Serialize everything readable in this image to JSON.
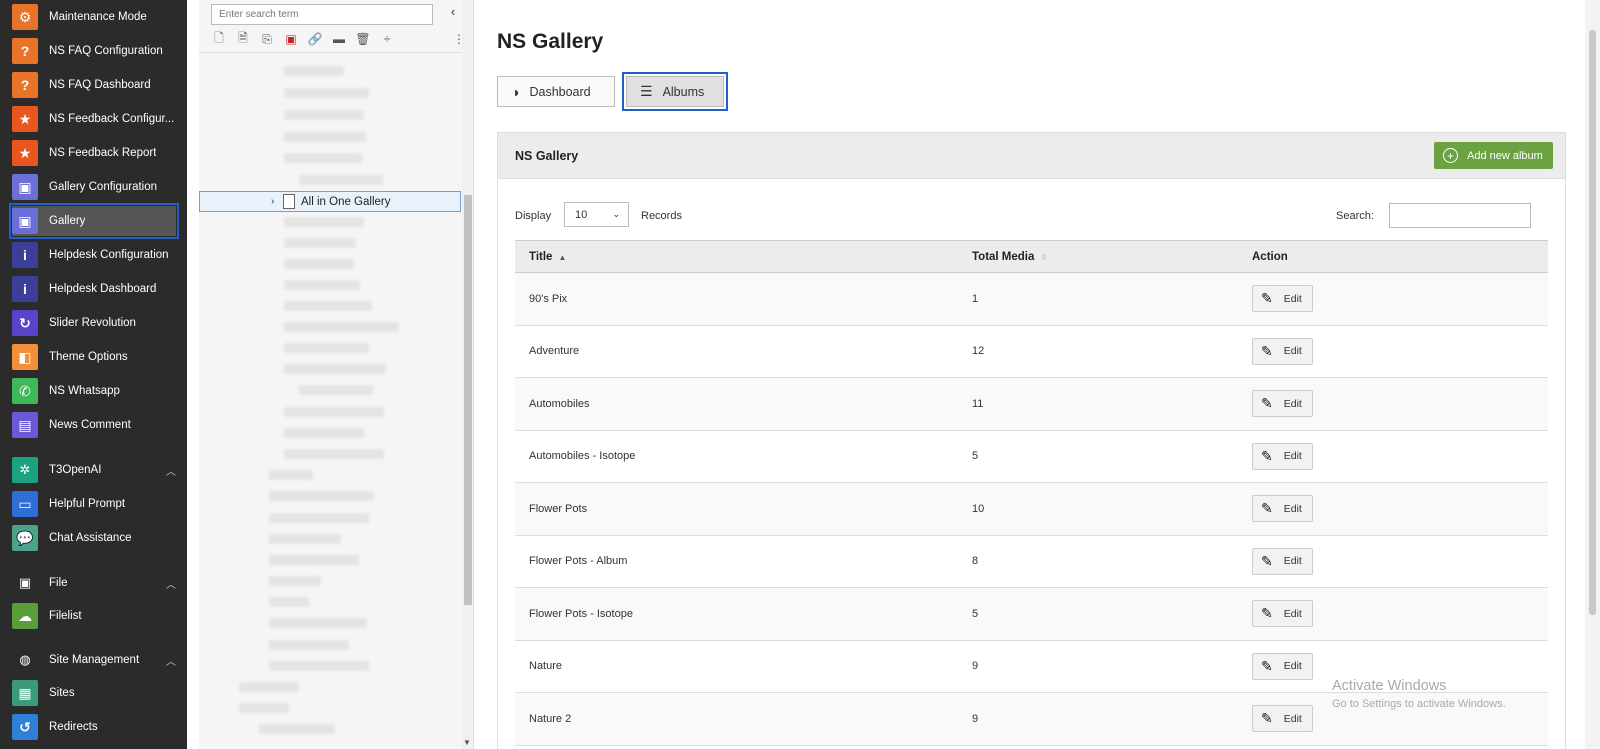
{
  "module_menu": {
    "items": [
      {
        "label": "Maintenance Mode",
        "icon": "gear-warning-icon",
        "color": "#e8742a"
      },
      {
        "label": "NS FAQ Configuration",
        "icon": "faq-icon",
        "color": "#e8742a"
      },
      {
        "label": "NS FAQ Dashboard",
        "icon": "faq-icon",
        "color": "#e8742a"
      },
      {
        "label": "NS Feedback Configur...",
        "icon": "star-icon",
        "color": "#e8571f"
      },
      {
        "label": "NS Feedback Report",
        "icon": "star-icon",
        "color": "#e8571f"
      },
      {
        "label": "Gallery Configuration",
        "icon": "image-icon",
        "color": "#6b6fd6"
      },
      {
        "label": "Gallery",
        "icon": "image-icon",
        "color": "#6b6fd6"
      },
      {
        "label": "Helpdesk Configuration",
        "icon": "info-icon",
        "color": "#3c3f9a"
      },
      {
        "label": "Helpdesk Dashboard",
        "icon": "info-icon",
        "color": "#3c3f9a"
      },
      {
        "label": "Slider Revolution",
        "icon": "refresh-icon",
        "color": "#5b43c9"
      },
      {
        "label": "Theme Options",
        "icon": "box-icon",
        "color": "#f0903a"
      },
      {
        "label": "NS Whatsapp",
        "icon": "whatsapp-icon",
        "color": "#3fb85a"
      },
      {
        "label": "News Comment",
        "icon": "comment-icon",
        "color": "#6a59d6"
      }
    ],
    "groups": [
      {
        "label": "T3OpenAI",
        "icon": "openai-icon",
        "color": "#19a37f",
        "items": [
          {
            "label": "Helpful Prompt",
            "icon": "prompt-icon",
            "color": "#2d6fd6"
          },
          {
            "label": "Chat Assistance",
            "icon": "chat-icon",
            "color": "#4aa38a"
          }
        ]
      },
      {
        "label": "File",
        "icon": "file-image-icon",
        "color": "#2b2b2b",
        "items": [
          {
            "label": "Filelist",
            "icon": "cloud-icon",
            "color": "#5a9e3c"
          }
        ]
      },
      {
        "label": "Site Management",
        "icon": "globe-icon",
        "color": "#2b2b2b",
        "items": [
          {
            "label": "Sites",
            "icon": "sites-icon",
            "color": "#3a9a7a"
          },
          {
            "label": "Redirects",
            "icon": "redirect-icon",
            "color": "#2f7fd6"
          }
        ]
      }
    ]
  },
  "tree": {
    "search_placeholder": "Enter search term",
    "selected_page": "All in One Gallery"
  },
  "main": {
    "title": "NS Gallery",
    "tabs": [
      {
        "label": "Dashboard",
        "icon": "gauge-icon"
      },
      {
        "label": "Albums",
        "icon": "list-icon"
      }
    ],
    "panel": {
      "title": "NS Gallery",
      "add_button": "Add new album",
      "display_label": "Display",
      "display_value": "10",
      "records_label": "Records",
      "search_label": "Search:",
      "columns": [
        "Title",
        "Total Media",
        "Action"
      ],
      "edit_label": "Edit",
      "rows": [
        {
          "title": "90's Pix",
          "media": "1"
        },
        {
          "title": "Adventure",
          "media": "12"
        },
        {
          "title": "Automobiles",
          "media": "11"
        },
        {
          "title": "Automobiles - Isotope",
          "media": "5"
        },
        {
          "title": "Flower Pots",
          "media": "10"
        },
        {
          "title": "Flower Pots - Album",
          "media": "8"
        },
        {
          "title": "Flower Pots - Isotope",
          "media": "5"
        },
        {
          "title": "Nature",
          "media": "9"
        },
        {
          "title": "Nature 2",
          "media": "9"
        }
      ]
    }
  },
  "watermark": {
    "line1": "Activate Windows",
    "line2": "Go to Settings to activate Windows."
  }
}
